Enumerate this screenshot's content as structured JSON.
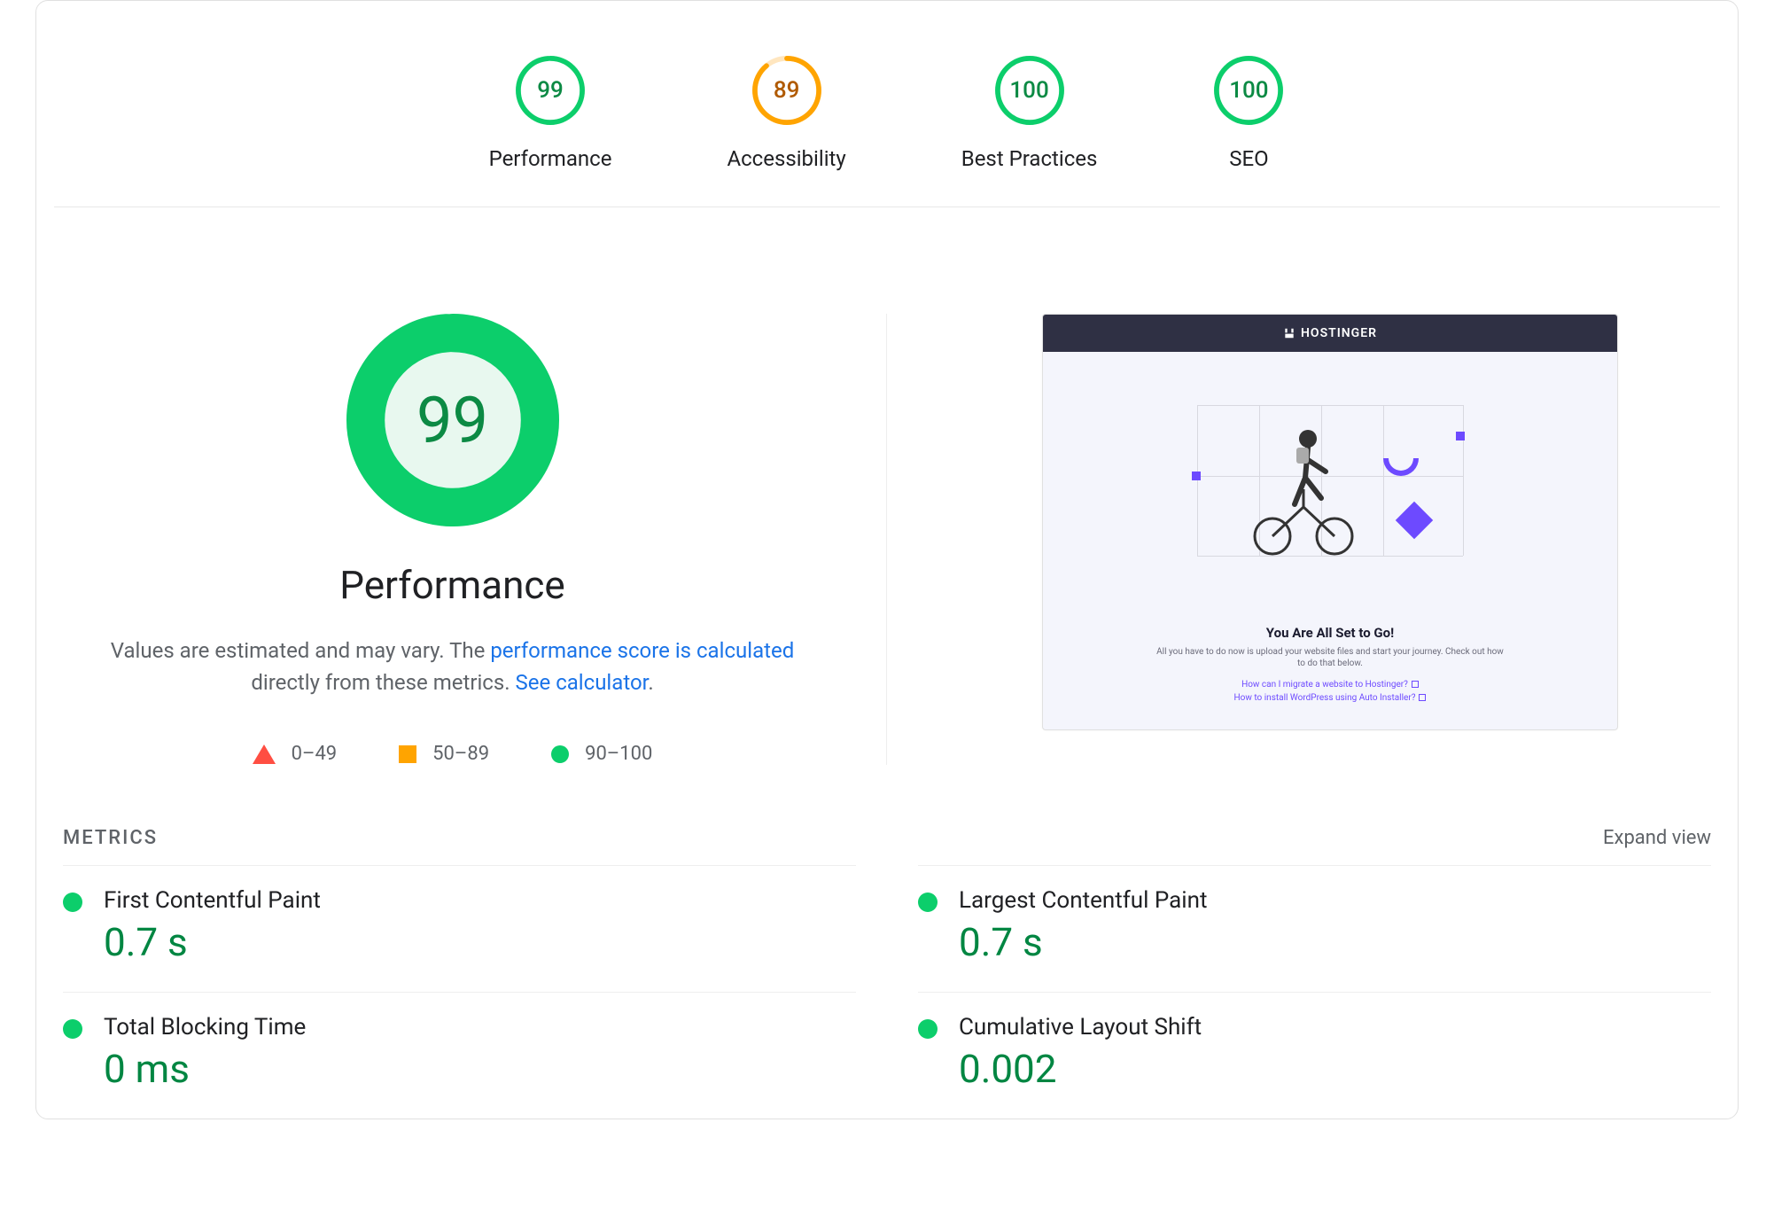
{
  "colors": {
    "green": "#0cce6b",
    "green_text": "#0c8a44",
    "green_light": "#e6f7ee",
    "orange": "#ffa400",
    "orange_text": "#b05a00",
    "orange_light": "#fff4e5",
    "red": "#ff4e42",
    "link": "#1a73e8"
  },
  "scores": [
    {
      "label": "Performance",
      "value": 99,
      "tier": "green"
    },
    {
      "label": "Accessibility",
      "value": 89,
      "tier": "orange"
    },
    {
      "label": "Best Practices",
      "value": 100,
      "tier": "green"
    },
    {
      "label": "SEO",
      "value": 100,
      "tier": "green"
    }
  ],
  "detail": {
    "score": 99,
    "tier": "green",
    "title": "Performance",
    "desc_prefix": "Values are estimated and may vary. The ",
    "desc_link1": "performance score is calculated",
    "desc_mid": " directly from these metrics. ",
    "desc_link2": "See calculator",
    "desc_suffix": "."
  },
  "legend": [
    {
      "shape": "triangle",
      "range": "0–49"
    },
    {
      "shape": "square",
      "range": "50–89"
    },
    {
      "shape": "circle",
      "range": "90–100"
    }
  ],
  "preview": {
    "brand": "HOSTINGER",
    "headline": "You Are All Set to Go!",
    "sub": "All you have to do now is upload your website files and start your journey. Check out how to do that below.",
    "link1": "How can I migrate a website to Hostinger?",
    "link2": "How to install WordPress using Auto Installer?"
  },
  "metrics_section": {
    "title": "METRICS",
    "expand": "Expand view"
  },
  "metrics": [
    {
      "name": "First Contentful Paint",
      "value": "0.7 s",
      "tier": "green"
    },
    {
      "name": "Largest Contentful Paint",
      "value": "0.7 s",
      "tier": "green"
    },
    {
      "name": "Total Blocking Time",
      "value": "0 ms",
      "tier": "green"
    },
    {
      "name": "Cumulative Layout Shift",
      "value": "0.002",
      "tier": "green"
    }
  ]
}
